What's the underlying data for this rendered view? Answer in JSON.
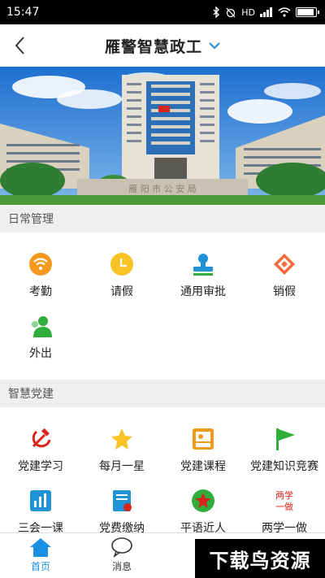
{
  "status_bar": {
    "time": "15:47",
    "network": "HD",
    "signal": "4G"
  },
  "header": {
    "title": "雁警智慧政工"
  },
  "banner": {
    "building_sign": "雁 阳 市 公 安 局"
  },
  "daily": {
    "title": "日常管理",
    "items": [
      {
        "label": "考勤",
        "icon": "wifi-icon"
      },
      {
        "label": "请假",
        "icon": "clock-icon"
      },
      {
        "label": "通用审批",
        "icon": "stamp-icon"
      },
      {
        "label": "销假",
        "icon": "eraser-icon"
      },
      {
        "label": "外出",
        "icon": "person-icon"
      }
    ]
  },
  "party": {
    "title": "智慧党建",
    "items": [
      {
        "label": "党建学习",
        "icon": "hammer-sickle-icon"
      },
      {
        "label": "每月一星",
        "icon": "star-icon"
      },
      {
        "label": "党建课程",
        "icon": "lecture-icon"
      },
      {
        "label": "党建知识竞赛",
        "icon": "flag-icon"
      },
      {
        "label": "三会一课",
        "icon": "chart-icon"
      },
      {
        "label": "党费缴纳",
        "icon": "document-icon"
      },
      {
        "label": "平语近人",
        "icon": "star-badge-icon"
      },
      {
        "label": "两学一做",
        "icon": "calligraphy-icon"
      }
    ],
    "calligraphy_text": "两学\n一做"
  },
  "tabs": [
    {
      "label": "首页",
      "icon": "home-icon"
    },
    {
      "label": "消息",
      "icon": "chat-icon"
    }
  ],
  "watermark": "下载鸟资源",
  "colors": {
    "accent": "#1a8fe3",
    "orange": "#f39a1e",
    "party_red": "#d7251b",
    "blue_icon": "#1f93d6",
    "green_icon": "#2fae3c"
  }
}
